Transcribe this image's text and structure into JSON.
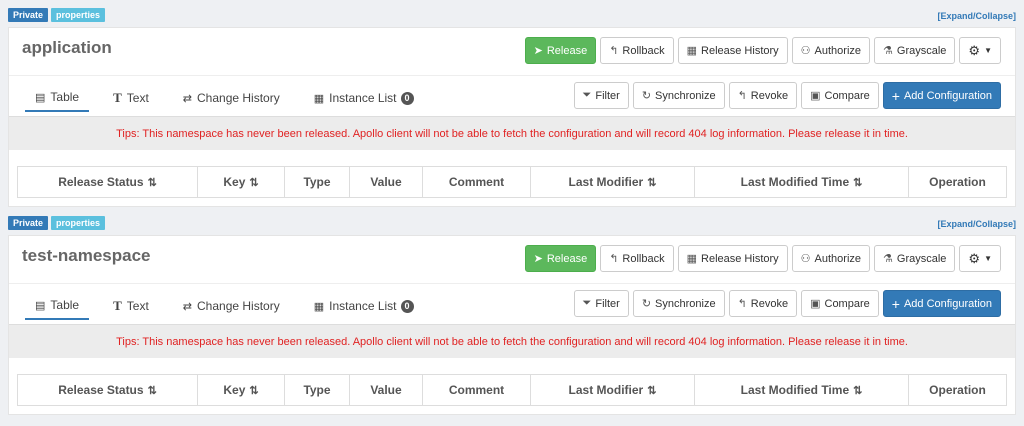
{
  "namespaces": [
    {
      "labels": {
        "private": "Private",
        "type": "properties"
      },
      "expand": "[Expand/Collapse]",
      "title": "application",
      "head_buttons": {
        "release": "Release",
        "rollback": "Rollback",
        "history": "Release History",
        "authorize": "Authorize",
        "grayscale": "Grayscale"
      },
      "tabs": {
        "table": "Table",
        "text": "Text",
        "change_history": "Change History",
        "instance_list": "Instance List",
        "instance_count": "0"
      },
      "tab_buttons": {
        "filter": "Filter",
        "sync": "Synchronize",
        "revoke": "Revoke",
        "compare": "Compare",
        "add": "Add Configuration"
      },
      "tips": "Tips: This namespace has never been released. Apollo client will not be able to fetch the configuration and will record 404 log information. Please release it in time.",
      "columns": [
        "Release Status",
        "Key",
        "Type",
        "Value",
        "Comment",
        "Last Modifier",
        "Last Modified Time",
        "Operation"
      ]
    },
    {
      "labels": {
        "private": "Private",
        "type": "properties"
      },
      "expand": "[Expand/Collapse]",
      "title": "test-namespace",
      "head_buttons": {
        "release": "Release",
        "rollback": "Rollback",
        "history": "Release History",
        "authorize": "Authorize",
        "grayscale": "Grayscale"
      },
      "tabs": {
        "table": "Table",
        "text": "Text",
        "change_history": "Change History",
        "instance_list": "Instance List",
        "instance_count": "0"
      },
      "tab_buttons": {
        "filter": "Filter",
        "sync": "Synchronize",
        "revoke": "Revoke",
        "compare": "Compare",
        "add": "Add Configuration"
      },
      "tips": "Tips: This namespace has never been released. Apollo client will not be able to fetch the configuration and will record 404 log information. Please release it in time.",
      "columns": [
        "Release Status",
        "Key",
        "Type",
        "Value",
        "Comment",
        "Last Modifier",
        "Last Modified Time",
        "Operation"
      ]
    }
  ],
  "colors": {
    "accent": "#337ab7",
    "success": "#5cb85c",
    "info": "#5bc0de",
    "danger": "#e02222"
  }
}
